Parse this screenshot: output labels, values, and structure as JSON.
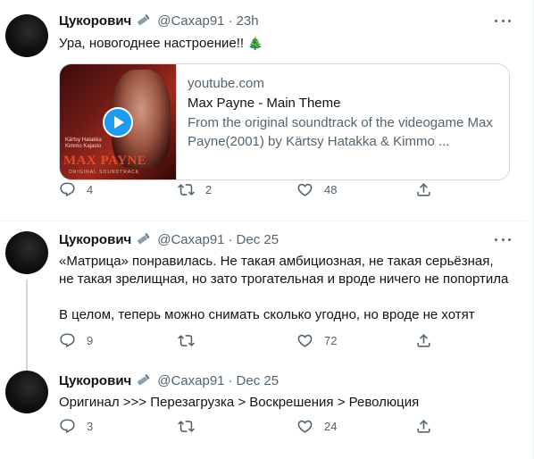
{
  "tweets": [
    {
      "author": "Цукорович",
      "handle": "@Caxap91",
      "time": "23h",
      "text": "Ура, новогоднее настроение!!",
      "emoji": "🎄",
      "card": {
        "thumbnail_small_text": "Kärtsy Hatakka\nKimmo Kajasto",
        "thumbnail_title": "MAX PAYNE",
        "thumbnail_subtitle": "ORIGINAL SOUNDTRACK",
        "domain": "youtube.com",
        "title": "Max Payne - Main Theme",
        "description": "From the original soundtrack of the videogame Max Payne(2001) by Kärtsy Hatakka & Kimmo ..."
      },
      "counts": {
        "replies": "4",
        "retweets": "2",
        "likes": "48",
        "share": ""
      }
    },
    {
      "author": "Цукорович",
      "handle": "@Caxap91",
      "time": "Dec 25",
      "paragraphs": [
        "«Матрица» понравилась. Не такая амбициозная, не такая серьёзная, не такая зрелищная, но зато трогательная и вроде ничего не попортила",
        "В целом, теперь можно снимать сколько угодно, но вроде не хотят"
      ],
      "counts": {
        "replies": "9",
        "retweets": "",
        "likes": "72",
        "share": ""
      }
    },
    {
      "author": "Цукорович",
      "handle": "@Caxap91",
      "time": "Dec 25",
      "text": "Оригинал >>> Перезагрузка > Воскрешения > Революция",
      "counts": {
        "replies": "3",
        "retweets": "",
        "likes": "24",
        "share": ""
      }
    }
  ],
  "separator": "·",
  "icons": {
    "author_badge": "syringe-icon",
    "more": "more-icon",
    "reply": "reply-icon",
    "retweet": "retweet-icon",
    "like": "heart-icon",
    "share": "share-icon",
    "play": "play-icon"
  },
  "colors": {
    "accent": "#1d9bf0",
    "text": "#0f1419",
    "secondary": "#536471",
    "border": "#cfd9de"
  }
}
